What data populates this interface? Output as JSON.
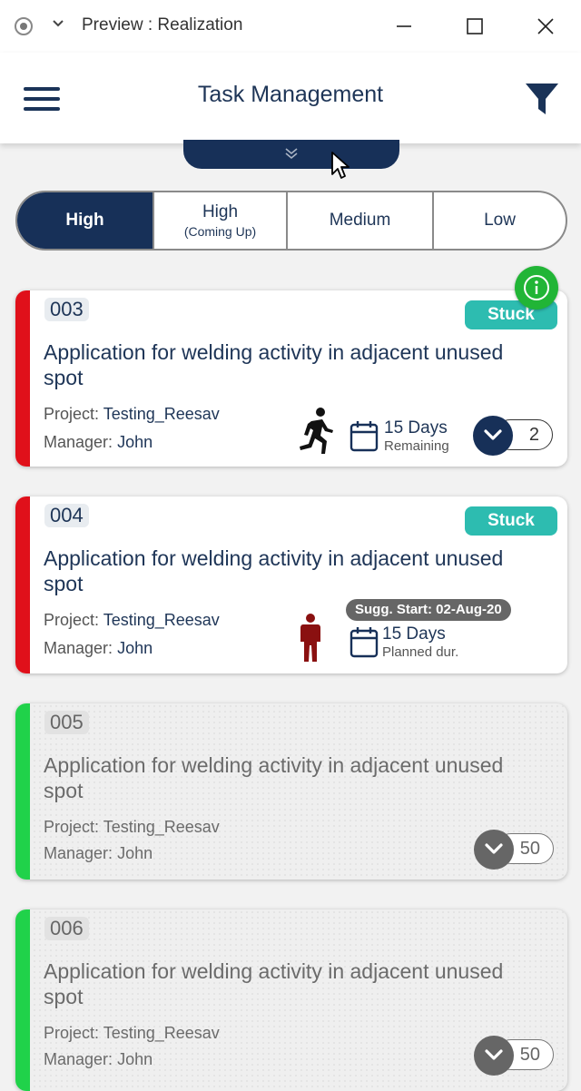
{
  "window": {
    "title": "Preview : Realization"
  },
  "header": {
    "title": "Task Management"
  },
  "tabs": [
    {
      "label": "High",
      "sub": "",
      "active": true
    },
    {
      "label": "High",
      "sub": "(Coming Up)",
      "active": false
    },
    {
      "label": "Medium",
      "sub": "",
      "active": false
    },
    {
      "label": "Low",
      "sub": "",
      "active": false
    }
  ],
  "tasks": [
    {
      "id": "003",
      "title": "Application for welding activity in adjacent unused spot",
      "project_label": "Project:",
      "project": "Testing_Reesav",
      "manager_label": "Manager:",
      "manager": "John",
      "status": "Stuck",
      "days": "15 Days",
      "days_note": "Remaining",
      "count": "2",
      "bar_color": "#e0101a"
    },
    {
      "id": "004",
      "title": "Application for welding activity in adjacent unused spot",
      "project_label": "Project:",
      "project": "Testing_Reesav",
      "manager_label": "Manager:",
      "manager": "John",
      "status": "Stuck",
      "suggested_start": "Sugg. Start: 02-Aug-20",
      "days": "15 Days",
      "days_note": "Planned dur.",
      "bar_color": "#e0101a"
    },
    {
      "id": "005",
      "title": "Application for welding activity in adjacent unused spot",
      "project_label": "Project:",
      "project": "Testing_Reesav",
      "manager_label": "Manager:",
      "manager": "John",
      "count": "50",
      "bar_color": "#20d24a"
    },
    {
      "id": "006",
      "title": "Application for welding activity in adjacent unused spot",
      "project_label": "Project:",
      "project": "Testing_Reesav",
      "manager_label": "Manager:",
      "manager": "John",
      "count": "50",
      "bar_color": "#20d24a"
    }
  ],
  "colors": {
    "navy": "#173058",
    "stuck": "#2dbcb0",
    "info": "#21b536"
  }
}
